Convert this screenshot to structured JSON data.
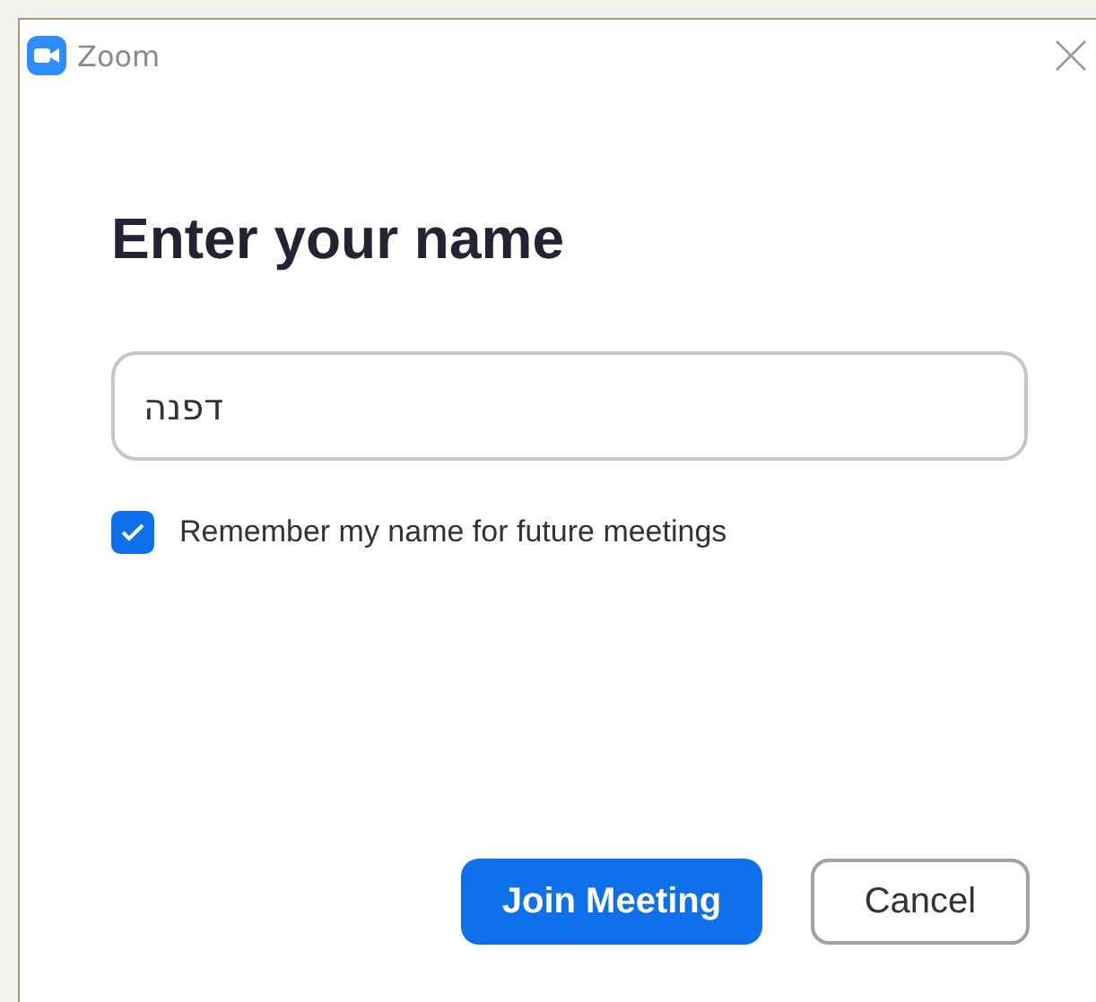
{
  "window": {
    "title": "Zoom"
  },
  "heading": "Enter your name",
  "name_field": {
    "value": "דפנה"
  },
  "remember": {
    "label": "Remember my name for future meetings",
    "checked": true
  },
  "buttons": [
    {
      "label": "Join Meeting",
      "kind": "primary"
    },
    {
      "label": "Cancel",
      "kind": "secondary"
    }
  ]
}
